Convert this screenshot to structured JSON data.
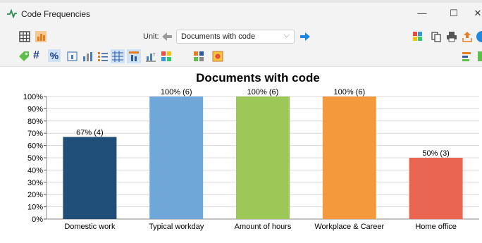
{
  "window": {
    "title": "Code Frequencies",
    "minimize": "—",
    "maximize": "☐",
    "close": "✕"
  },
  "toolbar": {
    "unit_label": "Unit:",
    "unit_value": "Documents with code",
    "prev_icon": "arrow-left-icon",
    "next_icon": "arrow-right-icon"
  },
  "colors": {
    "domestic": "#1f4e79",
    "typical": "#6fa8d8",
    "amount": "#9bc857",
    "workplace": "#f39a3c",
    "home": "#eb6650"
  },
  "chart_data": {
    "type": "bar",
    "title": "Documents with code",
    "categories": [
      "Domestic work",
      "Typical workday",
      "Amount of hours",
      "Workplace & Career",
      "Home office"
    ],
    "values": [
      67,
      100,
      100,
      100,
      50
    ],
    "data_labels": [
      "67% (4)",
      "100% (6)",
      "100% (6)",
      "100% (6)",
      "50% (3)"
    ],
    "colors": [
      "#1f4e79",
      "#6fa8d8",
      "#9bc857",
      "#f39a3c",
      "#eb6650"
    ],
    "y_ticks": [
      "0%",
      "10%",
      "20%",
      "30%",
      "40%",
      "50%",
      "60%",
      "70%",
      "80%",
      "90%",
      "100%"
    ],
    "ylim": [
      0,
      100
    ],
    "xlabel": "",
    "ylabel": "",
    "grid": true,
    "legend": "none"
  }
}
